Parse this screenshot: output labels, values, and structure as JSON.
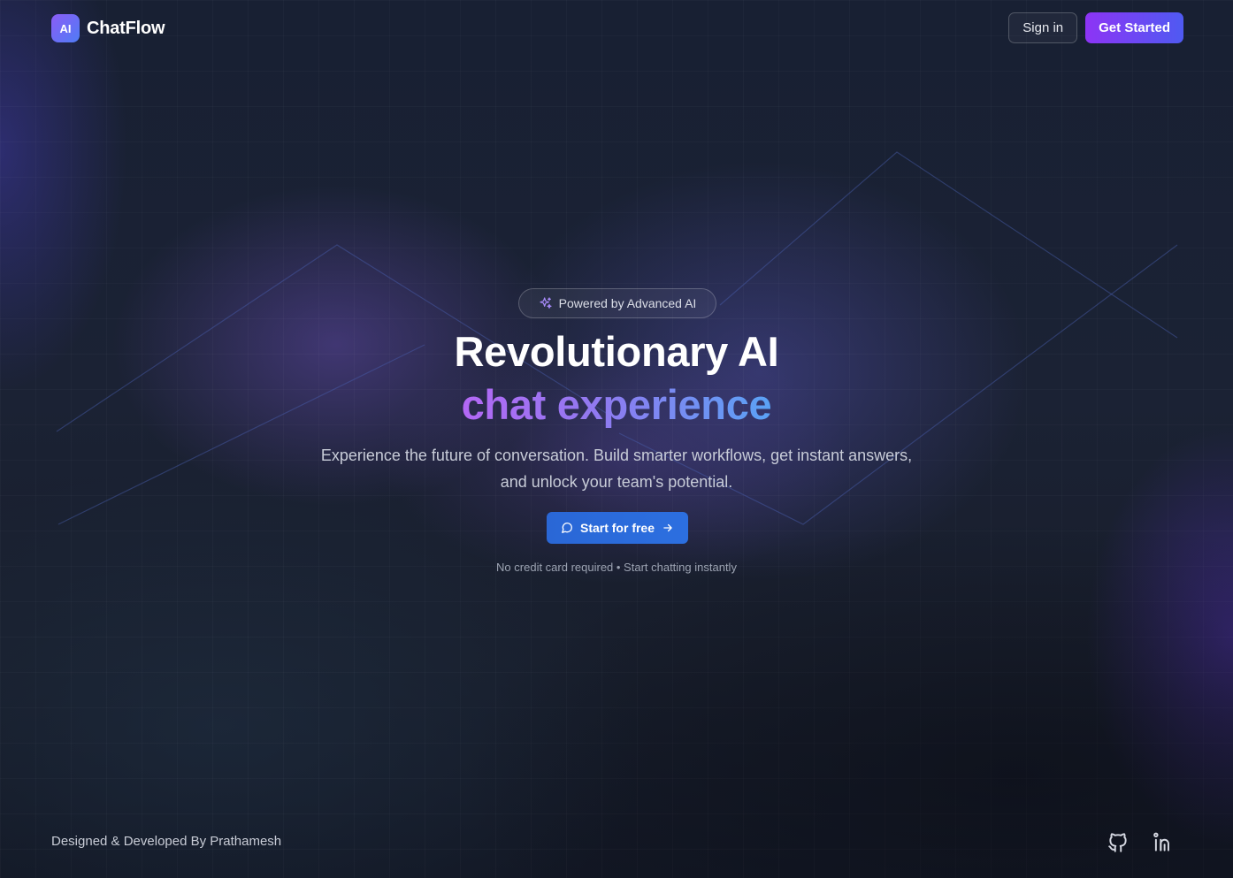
{
  "brand": {
    "badge": "AI",
    "name": "ChatFlow"
  },
  "nav": {
    "signin_label": "Sign in",
    "get_started_label": "Get Started"
  },
  "hero": {
    "pill_icon": "sparkles-icon",
    "pill_text": "Powered by Advanced AI",
    "title_line1": "Revolutionary AI",
    "title_line2": "chat experience",
    "description": "Experience the future of conversation. Build smarter workflows, get instant answers, and unlock your team's potential.",
    "cta_icon": "message-circle-icon",
    "cta_label": "Start for free",
    "cta_arrow_icon": "arrow-right-icon",
    "note": "No credit card required • Start chatting instantly"
  },
  "footer": {
    "credit": "Designed & Developed By Prathamesh",
    "social": [
      {
        "name": "GitHub",
        "icon": "github-icon"
      },
      {
        "name": "LinkedIn",
        "icon": "linkedin-icon"
      }
    ]
  },
  "colors": {
    "background": "#1b2234",
    "accent_purple": "#8d34f5",
    "accent_blue": "#4f5af2",
    "cta_blue": "#2c6fe0",
    "gradient_text_start": "#b468f5",
    "gradient_text_end": "#5aa2f5"
  }
}
